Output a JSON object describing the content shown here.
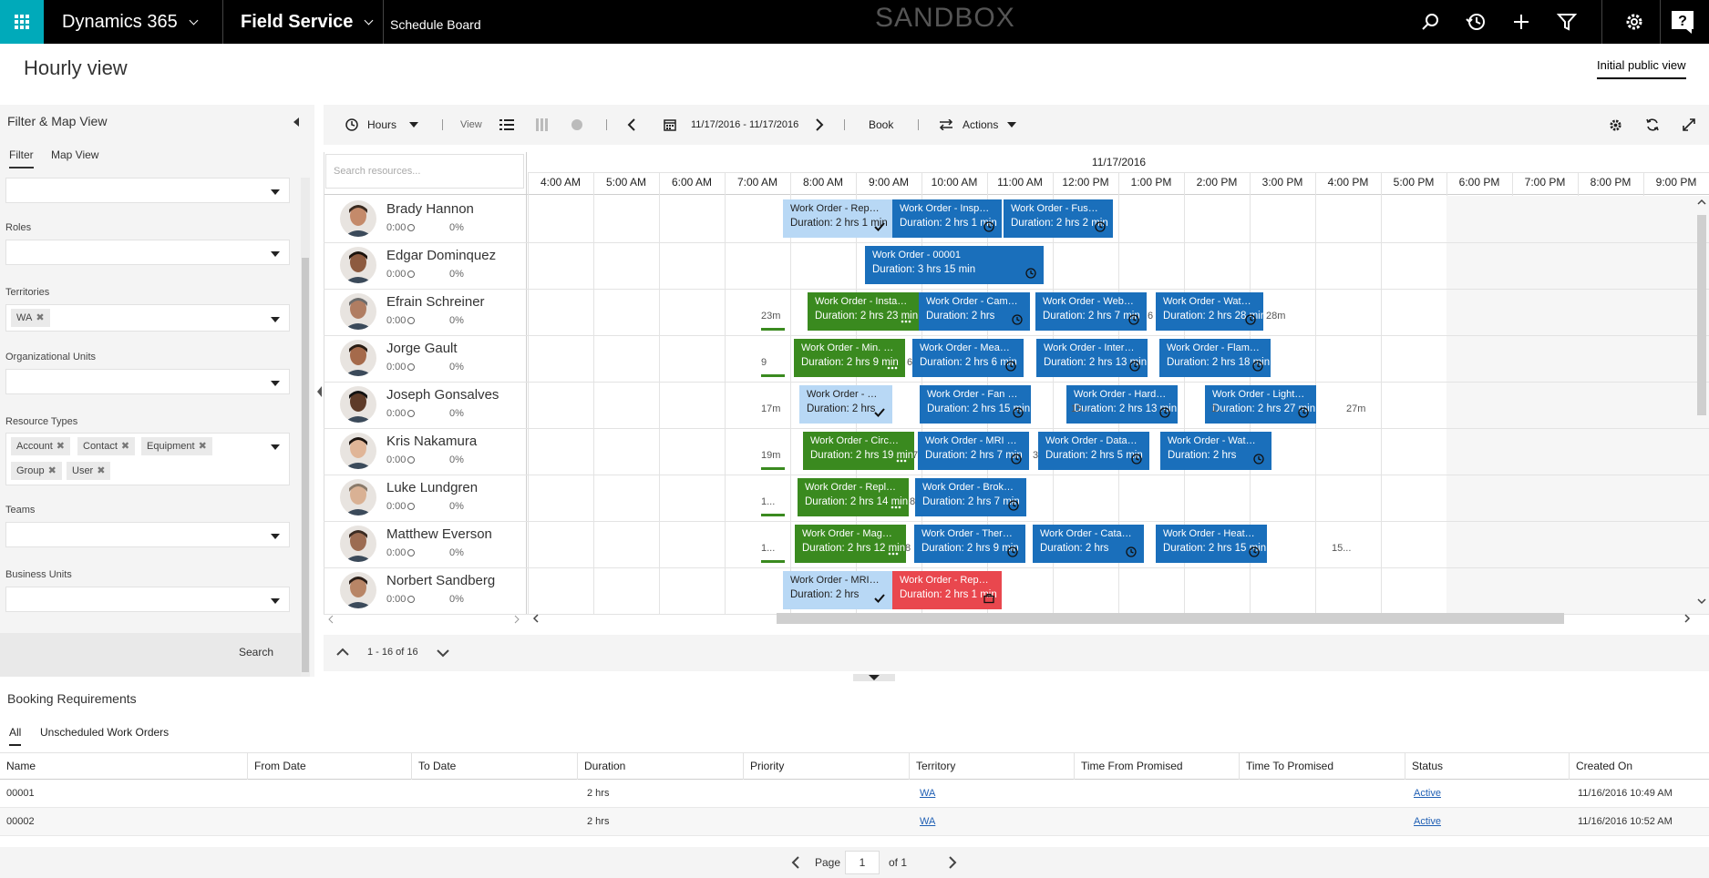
{
  "topbar": {
    "app_name": "Dynamics 365",
    "area_name": "Field Service",
    "page_name": "Schedule Board",
    "environment_label": "SANDBOX"
  },
  "header": {
    "title": "Hourly view",
    "view_tab": "Initial public view"
  },
  "filter_panel": {
    "title": "Filter & Map View",
    "tabs": [
      "Filter",
      "Map View"
    ],
    "labels": {
      "roles": "Roles",
      "territories": "Territories",
      "org_units": "Organizational Units",
      "resource_types": "Resource Types",
      "teams": "Teams",
      "business_units": "Business Units"
    },
    "territory_chips": [
      "WA"
    ],
    "resource_type_chips": [
      "Account",
      "Contact",
      "Equipment",
      "Group",
      "User"
    ],
    "search_button": "Search"
  },
  "toolbar": {
    "scale_label": "Hours",
    "view_label": "View",
    "date_range": "11/17/2016 - 11/17/2016",
    "book_label": "Book",
    "actions_label": "Actions"
  },
  "board": {
    "search_placeholder": "Search resources...",
    "date": "11/17/2016",
    "hours": [
      "4:00 AM",
      "5:00 AM",
      "6:00 AM",
      "7:00 AM",
      "8:00 AM",
      "9:00 AM",
      "10:00 AM",
      "11:00 AM",
      "12:00 PM",
      "1:00 PM",
      "2:00 PM",
      "3:00 PM",
      "4:00 PM",
      "5:00 PM",
      "6:00 PM",
      "7:00 PM",
      "8:00 PM",
      "9:00 PM"
    ],
    "resources": [
      {
        "name": "Brady Hannon",
        "hours": "0:00",
        "pct": "0%"
      },
      {
        "name": "Edgar Dominquez",
        "hours": "0:00",
        "pct": "0%"
      },
      {
        "name": "Efrain Schreiner",
        "hours": "0:00",
        "pct": "0%"
      },
      {
        "name": "Jorge Gault",
        "hours": "0:00",
        "pct": "0%"
      },
      {
        "name": "Joseph Gonsalves",
        "hours": "0:00",
        "pct": "0%"
      },
      {
        "name": "Kris Nakamura",
        "hours": "0:00",
        "pct": "0%"
      },
      {
        "name": "Luke Lundgren",
        "hours": "0:00",
        "pct": "0%"
      },
      {
        "name": "Matthew Everson",
        "hours": "0:00",
        "pct": "0%"
      },
      {
        "name": "Norbert Sandberg",
        "hours": "0:00",
        "pct": "0%"
      }
    ],
    "bookings": [
      {
        "title": "Work Order - Replace ...",
        "duration": "Duration: 2 hrs 1 min",
        "color": "light",
        "icon": "check-icon"
      },
      {
        "title": "Work Order - Inspectio...",
        "duration": "Duration: 2 hrs 1 min",
        "color": "blue",
        "icon": "clock-icon"
      },
      {
        "title": "Work Order - Fuse out",
        "duration": "Duration: 2 hrs 2 min",
        "color": "blue",
        "icon": "clock-icon"
      },
      {
        "title": "Work Order - 00001",
        "duration": "Duration: 3 hrs 15 min",
        "color": "blue",
        "icon": "clock-icon"
      },
      {
        "title": "Work Order - Install Ne...",
        "duration": "Duration: 2 hrs 23 min",
        "color": "green",
        "icon": "more-icon"
      },
      {
        "title": "Work Order - Camera is...",
        "duration": "Duration: 2 hrs",
        "color": "blue",
        "icon": "clock-icon"
      },
      {
        "title": "Work Order - Website d...",
        "duration": "Duration: 2 hrs 7 min",
        "color": "blue",
        "icon": "clock-icon"
      },
      {
        "title": "Work Order - Water sup...",
        "duration": "Duration: 2 hrs 28 min",
        "color": "blue",
        "icon": "clock-icon"
      },
      {
        "title": "Work Order - Min. Diag...",
        "duration": "Duration: 2 hrs 9 min",
        "color": "green",
        "icon": "more-icon"
      },
      {
        "title": "Work Order - Measure ...",
        "duration": "Duration: 2 hrs 6 min",
        "color": "blue",
        "icon": "clock-icon"
      },
      {
        "title": "Work Order - Internet c...",
        "duration": "Duration: 2 hrs 13 min",
        "color": "blue",
        "icon": "clock-icon"
      },
      {
        "title": "Work Order - Flame sha...",
        "duration": "Duration: 2 hrs 18 min",
        "color": "blue",
        "icon": "clock-icon"
      },
      {
        "title": "Work Order - Repla...",
        "duration": "Duration: 2 hrs",
        "color": "light",
        "icon": "check-icon"
      },
      {
        "title": "Work Order - Fan not w...",
        "duration": "Duration: 2 hrs 15 min",
        "color": "blue",
        "icon": "clock-icon"
      },
      {
        "title": "Work Order - Hard disk ...",
        "duration": "Duration: 2 hrs 13 min",
        "color": "blue",
        "icon": "clock-icon"
      },
      {
        "title": "Work Order - Light bulbs",
        "duration": "Duration: 2 hrs 27 min",
        "color": "blue",
        "icon": "clock-icon"
      },
      {
        "title": "Work Order - Circuit Re...",
        "duration": "Duration: 2 hrs 19 min",
        "color": "green",
        "icon": "more-icon"
      },
      {
        "title": "Work Order - MRI Cycl...",
        "duration": "Duration: 2 hrs 7 min",
        "color": "blue",
        "icon": "clock-icon"
      },
      {
        "title": "Work Order - Data file c...",
        "duration": "Duration: 2 hrs 5 min",
        "color": "blue",
        "icon": "clock-icon"
      },
      {
        "title": "Work Order - Water pr...",
        "duration": "Duration: 2 hrs",
        "color": "blue",
        "icon": "clock-icon"
      },
      {
        "title": "Work Order - Replace Sl...",
        "duration": "Duration: 2 hrs 14 min",
        "color": "green",
        "icon": "more-icon"
      },
      {
        "title": "Work Order - Broken T...",
        "duration": "Duration: 2 hrs 7 min",
        "color": "blue",
        "icon": "clock-icon"
      },
      {
        "title": "Work Order - Magnetis...",
        "duration": "Duration: 2 hrs 12 min",
        "color": "green",
        "icon": "more-icon"
      },
      {
        "title": "Work Order - Thermost...",
        "duration": "Duration: 2 hrs 9 min",
        "color": "blue",
        "icon": "clock-icon"
      },
      {
        "title": "Work Order - Catalog i...",
        "duration": "Duration: 2 hrs",
        "color": "blue",
        "icon": "clock-icon"
      },
      {
        "title": "Work Order - Heating fl...",
        "duration": "Duration: 2 hrs 15 min",
        "color": "blue",
        "icon": "clock-icon"
      },
      {
        "title": "Work Order - MRI Sanit...",
        "duration": "Duration: 2 hrs",
        "color": "light",
        "icon": "check-icon"
      },
      {
        "title": "Work Order - Replace ...",
        "duration": "Duration: 2 hrs 1 min",
        "color": "red",
        "icon": "briefcase-icon"
      }
    ],
    "travel": [
      "23m",
      "6",
      "28m",
      "9",
      "6",
      "17m",
      "15...",
      "1...",
      "27m",
      "19m",
      "7",
      "3",
      "1...",
      "8",
      "1...",
      "8",
      "15..."
    ],
    "pager": "1 - 16 of 16"
  },
  "requirements": {
    "title": "Booking Requirements",
    "tabs": [
      "All",
      "Unscheduled Work Orders"
    ],
    "columns": [
      "Name",
      "From Date",
      "To Date",
      "Duration",
      "Priority",
      "Territory",
      "Time From Promised",
      "Time To Promised",
      "Status",
      "Created On"
    ],
    "rows": [
      {
        "name": "00001",
        "duration": "2 hrs",
        "territory": "WA",
        "status": "Active",
        "created": "11/16/2016 10:49 AM"
      },
      {
        "name": "00002",
        "duration": "2 hrs",
        "territory": "WA",
        "status": "Active",
        "created": "11/16/2016 10:52 AM"
      }
    ],
    "pager": {
      "page_label": "Page",
      "page": "1",
      "of_label": "of 1"
    }
  },
  "colors": {
    "brand_teal": "#00aaba",
    "booking_blue": "#1a6fbb",
    "booking_green": "#3a8a1f",
    "booking_light": "#b8d8f5",
    "booking_red": "#e9474e"
  }
}
